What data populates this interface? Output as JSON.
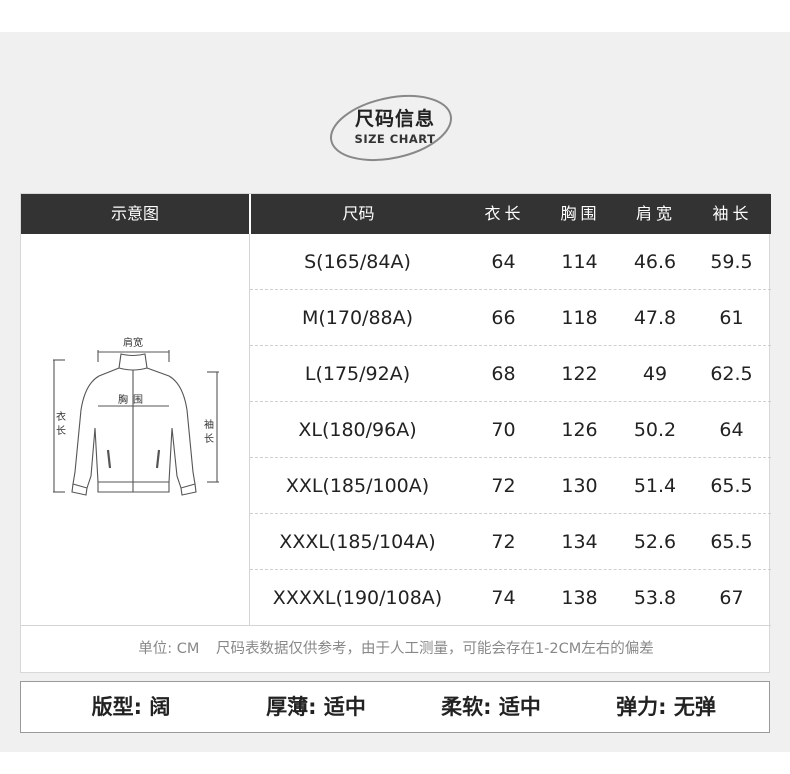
{
  "title": {
    "cn": "尺码信息",
    "en": "SIZE CHART"
  },
  "table": {
    "headers": [
      "示意图",
      "尺码",
      "衣长",
      "胸围",
      "肩宽",
      "袖长"
    ],
    "rows": [
      [
        "S(165/84A)",
        "64",
        "114",
        "46.6",
        "59.5"
      ],
      [
        "M(170/88A)",
        "66",
        "118",
        "47.8",
        "61"
      ],
      [
        "L(175/92A)",
        "68",
        "122",
        "49",
        "62.5"
      ],
      [
        "XL(180/96A)",
        "70",
        "126",
        "50.2",
        "64"
      ],
      [
        "XXL(185/100A)",
        "72",
        "130",
        "51.4",
        "65.5"
      ],
      [
        "XXXL(185/104A)",
        "72",
        "134",
        "52.6",
        "65.5"
      ],
      [
        "XXXXL(190/108A)",
        "74",
        "138",
        "53.8",
        "67"
      ]
    ]
  },
  "diagram": {
    "shoulder": "肩宽",
    "chest": "胸围",
    "length_1": "衣",
    "length_2": "长",
    "sleeve_1": "袖",
    "sleeve_2": "长"
  },
  "note": {
    "unit": "单位: CM",
    "text": "尺码表数据仅供参考，由于人工测量，可能会存在1-2CM左右的偏差"
  },
  "specs": [
    {
      "label": "版型:",
      "value": "阔"
    },
    {
      "label": "厚薄:",
      "value": "适中"
    },
    {
      "label": "柔软:",
      "value": "适中"
    },
    {
      "label": "弹力:",
      "value": "无弹"
    }
  ]
}
